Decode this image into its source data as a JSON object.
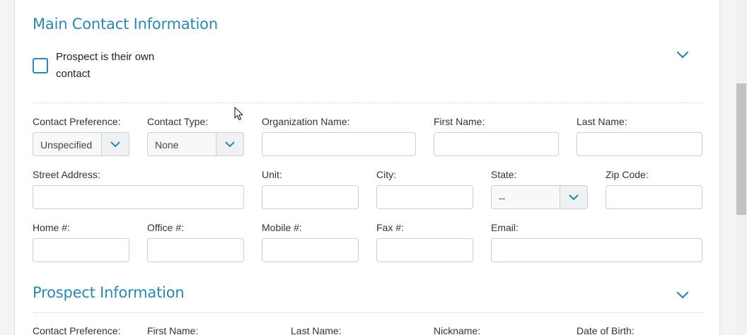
{
  "main_contact": {
    "title": "Main Contact Information",
    "own_contact_checkbox": {
      "label_line1": "Prospect is their own",
      "label_line2": "contact",
      "checked": false
    },
    "fields": {
      "contact_preference": {
        "label": "Contact Preference:",
        "value": "Unspecified"
      },
      "contact_type": {
        "label": "Contact Type:",
        "value": "None"
      },
      "organization_name": {
        "label": "Organization Name:",
        "value": ""
      },
      "first_name": {
        "label": "First Name:",
        "value": ""
      },
      "last_name": {
        "label": "Last Name:",
        "value": ""
      },
      "street_address": {
        "label": "Street Address:",
        "value": ""
      },
      "unit": {
        "label": "Unit:",
        "value": ""
      },
      "city": {
        "label": "City:",
        "value": ""
      },
      "state": {
        "label": "State:",
        "value": "--"
      },
      "zip_code": {
        "label": "Zip Code:",
        "value": ""
      },
      "home": {
        "label": "Home #:",
        "value": ""
      },
      "office": {
        "label": "Office #:",
        "value": ""
      },
      "mobile": {
        "label": "Mobile #:",
        "value": ""
      },
      "fax": {
        "label": "Fax #:",
        "value": ""
      },
      "email": {
        "label": "Email:",
        "value": ""
      }
    }
  },
  "prospect_info": {
    "title": "Prospect Information",
    "labels": {
      "contact_preference": "Contact Preference:",
      "first_name": "First Name:",
      "last_name": "Last Name:",
      "nickname": "Nickname:",
      "date_of_birth": "Date of Birth:"
    }
  },
  "colors": {
    "accent": "#2d86ab",
    "border": "#c9cfd3",
    "background": "#f2f4f5"
  },
  "icons": {
    "collapse": "chevron-down-icon",
    "select_toggle": "chevron-down-icon",
    "cursor": "mouse-pointer-icon"
  }
}
